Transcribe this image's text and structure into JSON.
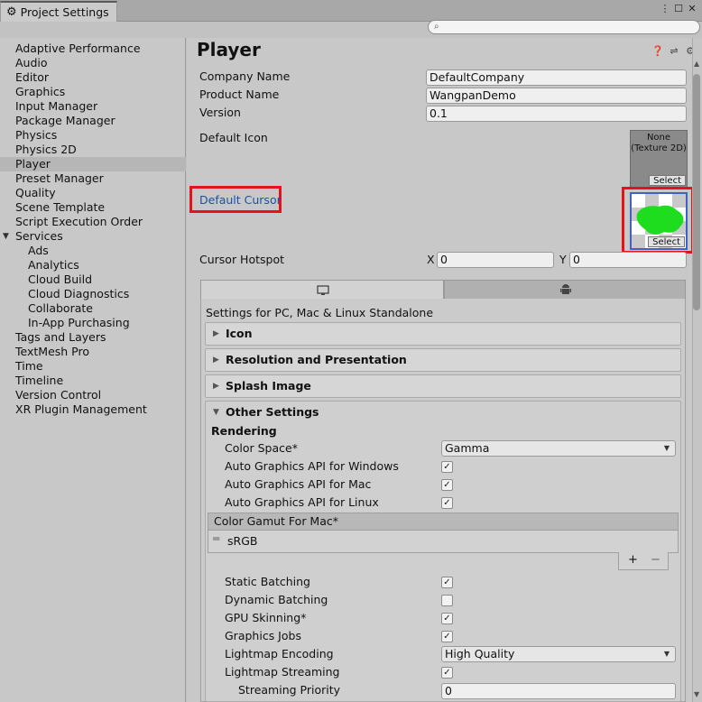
{
  "window": {
    "tab_title": "Project Settings",
    "search_placeholder": ""
  },
  "sidebar": {
    "items": [
      {
        "label": "Adaptive Performance"
      },
      {
        "label": "Audio"
      },
      {
        "label": "Editor"
      },
      {
        "label": "Graphics"
      },
      {
        "label": "Input Manager"
      },
      {
        "label": "Package Manager"
      },
      {
        "label": "Physics"
      },
      {
        "label": "Physics 2D"
      },
      {
        "label": "Player",
        "selected": true
      },
      {
        "label": "Preset Manager"
      },
      {
        "label": "Quality"
      },
      {
        "label": "Scene Template"
      },
      {
        "label": "Script Execution Order"
      },
      {
        "label": "Services",
        "expanded": true
      },
      {
        "label": "Ads",
        "child": true
      },
      {
        "label": "Analytics",
        "child": true
      },
      {
        "label": "Cloud Build",
        "child": true
      },
      {
        "label": "Cloud Diagnostics",
        "child": true
      },
      {
        "label": "Collaborate",
        "child": true
      },
      {
        "label": "In-App Purchasing",
        "child": true
      },
      {
        "label": "Tags and Layers"
      },
      {
        "label": "TextMesh Pro"
      },
      {
        "label": "Time"
      },
      {
        "label": "Timeline"
      },
      {
        "label": "Version Control"
      },
      {
        "label": "XR Plugin Management"
      }
    ]
  },
  "player": {
    "title": "Player",
    "company_name_label": "Company Name",
    "company_name_value": "DefaultCompany",
    "product_name_label": "Product Name",
    "product_name_value": "WangpanDemo",
    "version_label": "Version",
    "version_value": "0.1",
    "default_icon_label": "Default Icon",
    "default_icon_slot": "None\n(Texture 2D)",
    "select_label": "Select",
    "default_cursor_label": "Default Cursor",
    "cursor_hotspot_label": "Cursor Hotspot",
    "hotspot_x_label": "X",
    "hotspot_x_value": "0",
    "hotspot_y_label": "Y",
    "hotspot_y_value": "0"
  },
  "platform": {
    "settings_heading": "Settings for PC, Mac & Linux Standalone",
    "sections": [
      "Icon",
      "Resolution and Presentation",
      "Splash Image",
      "Other Settings"
    ]
  },
  "other_settings": {
    "rendering_heading": "Rendering",
    "color_space_label": "Color Space*",
    "color_space_value": "Gamma",
    "api_windows_label": "Auto Graphics API  for Windows",
    "api_mac_label": "Auto Graphics API  for Mac",
    "api_linux_label": "Auto Graphics API  for Linux",
    "color_gamut_label": "Color Gamut For Mac*",
    "color_gamut_item": "sRGB",
    "add_symbol": "+",
    "remove_symbol": "−",
    "static_batching_label": "Static Batching",
    "dynamic_batching_label": "Dynamic Batching",
    "gpu_skinning_label": "GPU Skinning*",
    "graphics_jobs_label": "Graphics Jobs",
    "lightmap_encoding_label": "Lightmap Encoding",
    "lightmap_encoding_value": "High Quality",
    "lightmap_streaming_label": "Lightmap Streaming",
    "streaming_priority_label": "Streaming Priority",
    "streaming_priority_value": "0",
    "checkbox_states": {
      "api_windows": true,
      "api_mac": true,
      "api_linux": true,
      "static_batching": true,
      "dynamic_batching": false,
      "gpu_skinning": true,
      "graphics_jobs": true,
      "lightmap_streaming": true
    }
  },
  "icons": {
    "tab": "gear-icon",
    "help": "help-icon",
    "presets": "sliders-icon",
    "settings": "gear-icon",
    "pc": "monitor-icon",
    "android": "android-icon"
  },
  "colors": {
    "highlight_box": "#e2131a",
    "link_label": "#1d4fa8",
    "cursor_green": "#1edc1e"
  }
}
